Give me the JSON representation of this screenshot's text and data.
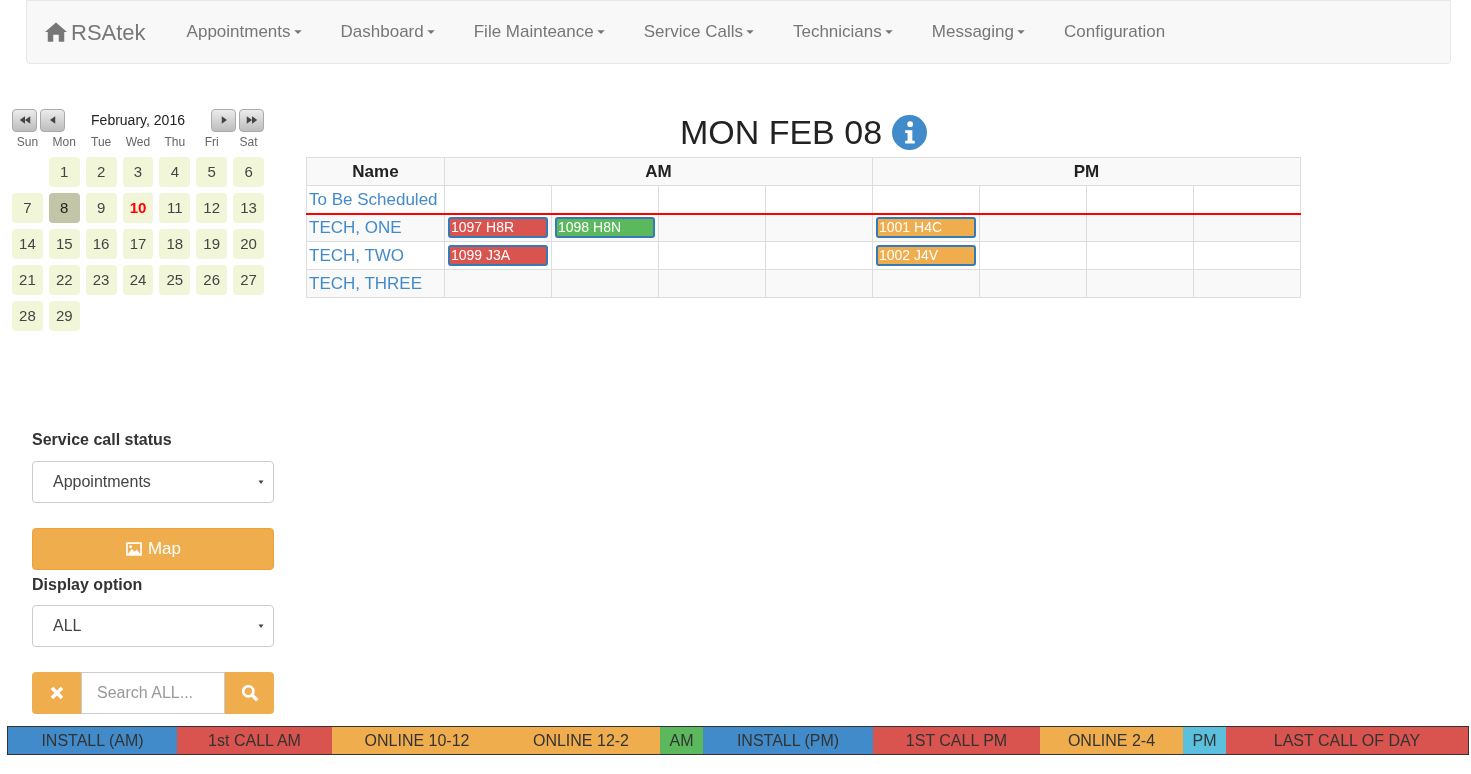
{
  "brand": "RSAtek",
  "nav": [
    {
      "label": "Appointments",
      "dropdown": true
    },
    {
      "label": "Dashboard",
      "dropdown": true
    },
    {
      "label": "File Mainteance",
      "dropdown": true
    },
    {
      "label": "Service Calls",
      "dropdown": true
    },
    {
      "label": "Technicians",
      "dropdown": true
    },
    {
      "label": "Messaging",
      "dropdown": true
    },
    {
      "label": "Configuration",
      "dropdown": false
    }
  ],
  "calendar": {
    "month": "February, 2016",
    "weekdays": [
      "Sun",
      "Mon",
      "Tue",
      "Wed",
      "Thu",
      "Fri",
      "Sat"
    ],
    "weeks": [
      [
        {
          "day": "1",
          "selected": false,
          "today": false
        },
        {
          "day": "2",
          "selected": false,
          "today": false
        },
        {
          "day": "3",
          "selected": false,
          "today": false
        },
        {
          "day": "4",
          "selected": false,
          "today": false
        },
        {
          "day": "5",
          "selected": false,
          "today": false
        },
        {
          "day": "6",
          "selected": false,
          "today": false
        }
      ],
      [
        {
          "day": "7",
          "selected": false,
          "today": false
        },
        {
          "day": "8",
          "selected": true,
          "today": false
        },
        {
          "day": "9",
          "selected": false,
          "today": false
        },
        {
          "day": "10",
          "selected": false,
          "today": true
        },
        {
          "day": "11",
          "selected": false,
          "today": false
        },
        {
          "day": "12",
          "selected": false,
          "today": false
        },
        {
          "day": "13",
          "selected": false,
          "today": false
        }
      ],
      [
        {
          "day": "14",
          "selected": false,
          "today": false
        },
        {
          "day": "15",
          "selected": false,
          "today": false
        },
        {
          "day": "16",
          "selected": false,
          "today": false
        },
        {
          "day": "17",
          "selected": false,
          "today": false
        },
        {
          "day": "18",
          "selected": false,
          "today": false
        },
        {
          "day": "19",
          "selected": false,
          "today": false
        },
        {
          "day": "20",
          "selected": false,
          "today": false
        }
      ],
      [
        {
          "day": "21",
          "selected": false,
          "today": false
        },
        {
          "day": "22",
          "selected": false,
          "today": false
        },
        {
          "day": "23",
          "selected": false,
          "today": false
        },
        {
          "day": "24",
          "selected": false,
          "today": false
        },
        {
          "day": "25",
          "selected": false,
          "today": false
        },
        {
          "day": "26",
          "selected": false,
          "today": false
        },
        {
          "day": "27",
          "selected": false,
          "today": false
        }
      ],
      [
        {
          "day": "28",
          "selected": false,
          "today": false
        },
        {
          "day": "29",
          "selected": false,
          "today": false
        }
      ]
    ]
  },
  "filters": {
    "status_label": "Service call status",
    "status_value": "Appointments",
    "map_button": "Map",
    "display_label": "Display option",
    "display_value": "ALL",
    "search_placeholder": "Search ALL..."
  },
  "schedule": {
    "title": "MON FEB 08",
    "columns": [
      "Name",
      "AM",
      "PM"
    ],
    "rows": [
      {
        "name": "To Be Scheduled",
        "kind": "unscheduled",
        "slots": [
          {
            "kind": "empty"
          },
          {
            "kind": "empty"
          },
          {
            "kind": "empty"
          },
          {
            "kind": "empty"
          },
          {
            "kind": "empty"
          },
          {
            "kind": "empty"
          },
          {
            "kind": "empty"
          },
          {
            "kind": "empty"
          }
        ]
      },
      {
        "name": "TECH, ONE",
        "kind": "tech",
        "slots": [
          {
            "kind": "appointment",
            "label": "1097 H8R",
            "color": "#d9534f"
          },
          {
            "kind": "appointment",
            "label": "1098 H8N",
            "color": "#5cb85c"
          },
          {
            "kind": "empty"
          },
          {
            "kind": "empty"
          },
          {
            "kind": "appointment",
            "label": "1001 H4C",
            "color": "#f0ad4e"
          },
          {
            "kind": "empty"
          },
          {
            "kind": "empty"
          },
          {
            "kind": "empty"
          }
        ]
      },
      {
        "name": "TECH, TWO",
        "kind": "tech",
        "slots": [
          {
            "kind": "appointment",
            "label": "1099 J3A",
            "color": "#d9534f"
          },
          {
            "kind": "empty"
          },
          {
            "kind": "empty"
          },
          {
            "kind": "empty"
          },
          {
            "kind": "appointment",
            "label": "1002 J4V",
            "color": "#f0ad4e"
          },
          {
            "kind": "empty"
          },
          {
            "kind": "empty"
          },
          {
            "kind": "empty"
          }
        ]
      },
      {
        "name": "TECH, THREE",
        "kind": "tech",
        "slots": [
          {
            "kind": "empty"
          },
          {
            "kind": "empty"
          },
          {
            "kind": "empty"
          },
          {
            "kind": "empty"
          },
          {
            "kind": "empty"
          },
          {
            "kind": "empty"
          },
          {
            "kind": "empty"
          },
          {
            "kind": "empty"
          }
        ]
      }
    ]
  },
  "legend": [
    {
      "label": "INSTALL (AM)",
      "color": "#428bca"
    },
    {
      "label": "1st CALL AM",
      "color": "#d9534f"
    },
    {
      "label": "ONLINE 10-12",
      "color": "#f0ad4e"
    },
    {
      "label": "ONLINE 12-2",
      "color": "#f0ad4e"
    },
    {
      "label": "AM",
      "color": "#5cb85c"
    },
    {
      "label": "INSTALL (PM)",
      "color": "#428bca"
    },
    {
      "label": "1ST CALL PM",
      "color": "#d9534f"
    },
    {
      "label": "ONLINE 2-4",
      "color": "#f0ad4e"
    },
    {
      "label": "PM",
      "color": "#5bc0de"
    },
    {
      "label": "LAST CALL OF DAY",
      "color": "#d9534f"
    }
  ]
}
